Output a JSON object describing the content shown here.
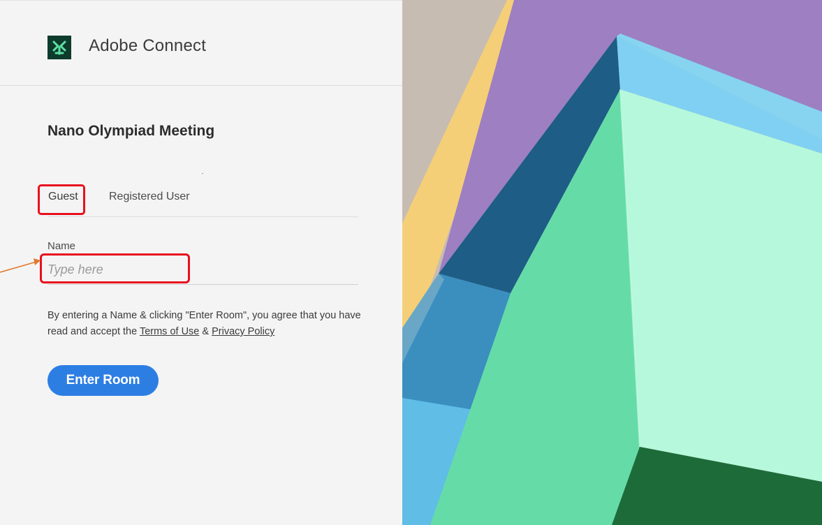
{
  "header": {
    "app_name": "Adobe Connect",
    "logo_icon": "adobe-connect-logo-icon"
  },
  "meeting": {
    "title": "Nano Olympiad Meeting"
  },
  "tabs": [
    {
      "label": "Guest",
      "active": true
    },
    {
      "label": "Registered User",
      "active": false
    }
  ],
  "form": {
    "name_label": "Name",
    "name_placeholder": "Type here",
    "name_value": ""
  },
  "consent": {
    "text_part1": "By entering a Name & clicking \"Enter Room\", you agree that you have read and accept the ",
    "terms_link": "Terms of Use",
    "separator": " & ",
    "privacy_link": "Privacy Policy"
  },
  "actions": {
    "enter_room_label": "Enter Room"
  },
  "colors": {
    "primary_button": "#2d7ee3",
    "annotation_highlight": "#e8101e",
    "annotation_arrow": "#e07a2e",
    "logo_background": "#0d3b2c"
  }
}
